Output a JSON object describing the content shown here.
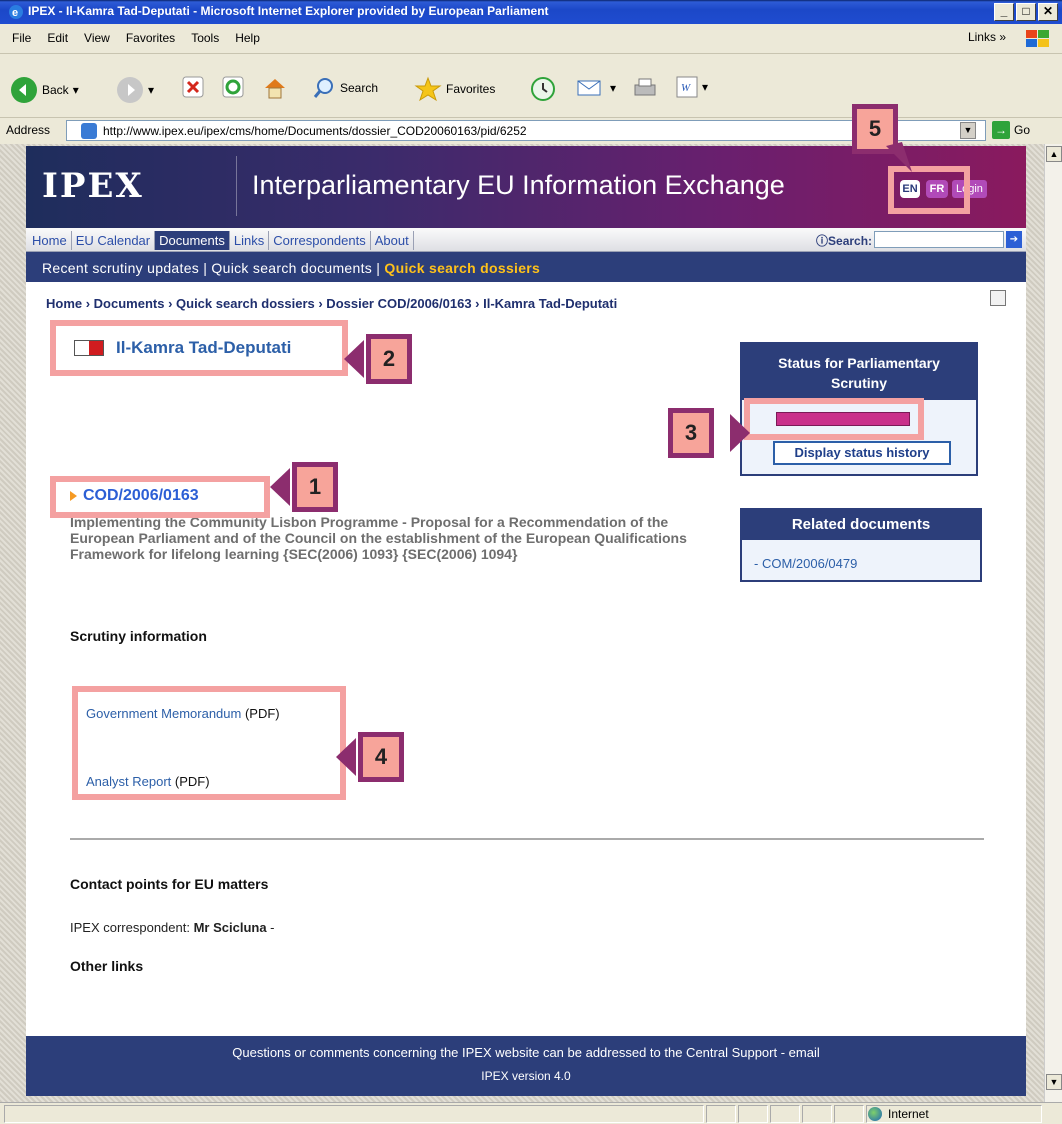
{
  "window": {
    "title": "IPEX - Il-Kamra Tad-Deputati - Microsoft Internet Explorer provided by European Parliament",
    "controls": [
      "_",
      "□",
      "✕"
    ]
  },
  "menu": {
    "items": [
      "File",
      "Edit",
      "View",
      "Favorites",
      "Tools",
      "Help"
    ],
    "links_label": "Links"
  },
  "toolbar": {
    "back_label": "Back",
    "search_label": "Search",
    "favorites_label": "Favorites"
  },
  "address": {
    "label": "Address",
    "url": "http://www.ipex.eu/ipex/cms/home/Documents/dossier_COD20060163/pid/6252",
    "go_label": "Go"
  },
  "site": {
    "logo": "IPEX",
    "title": "Interparliamentary EU Information Exchange",
    "lang_en": "EN",
    "lang_fr": "FR",
    "login": "Login"
  },
  "nav": {
    "tabs": [
      "Home",
      "EU Calendar",
      "Documents",
      "Links",
      "Correspondents",
      "About"
    ],
    "search_label": "Search:",
    "subnav_item1": "Recent scrutiny updates",
    "subnav_item2": "Quick search documents",
    "subnav_item3": "Quick search dossiers"
  },
  "breadcrumb": "Home  ›  Documents  ›  Quick search dossiers  ›  Dossier COD/2006/0163  ›  Il-Kamra Tad-Deputati",
  "parliament": {
    "name": "Il-Kamra Tad-Deputati"
  },
  "dossier": {
    "ref": "COD/2006/0163",
    "description": "Implementing the Community Lisbon Programme - Proposal for a Recommendation of the European Parliament and of the Council on the establishment of the European Qualifications Framework for lifelong learning {SEC(2006) 1093} {SEC(2006) 1094}"
  },
  "scrutiny": {
    "heading": "Scrutiny information",
    "doc1_link": "Government Memorandum",
    "doc1_suffix": "(PDF)",
    "doc2_link": "Analyst Report",
    "doc2_suffix": "(PDF)"
  },
  "status_box": {
    "heading_line1": "Status for Parliamentary",
    "heading_line2": "Scrutiny",
    "history_button": "Display status history"
  },
  "related": {
    "heading": "Related documents",
    "item_prefix": "- ",
    "item": "COM/2006/0479"
  },
  "contact": {
    "heading": "Contact points for EU matters",
    "correspondent_label": "IPEX correspondent:",
    "correspondent_name": "Mr Scicluna",
    "correspondent_suffix": " -",
    "other_links": "Other links"
  },
  "footer": {
    "line1": "Questions or comments concerning the IPEX website can be addressed to the Central Support - email",
    "line2": "IPEX version 4.0"
  },
  "browser_status": {
    "zone": "Internet"
  },
  "annotations": [
    "1",
    "2",
    "3",
    "4",
    "5"
  ],
  "colors": {
    "header_navy": "#2c3e7a",
    "highlight_pink": "#f4a1a1",
    "callout_purple": "#8c2d6e",
    "accent_yellow": "#ffc21a",
    "status_magenta": "#c9308a"
  }
}
